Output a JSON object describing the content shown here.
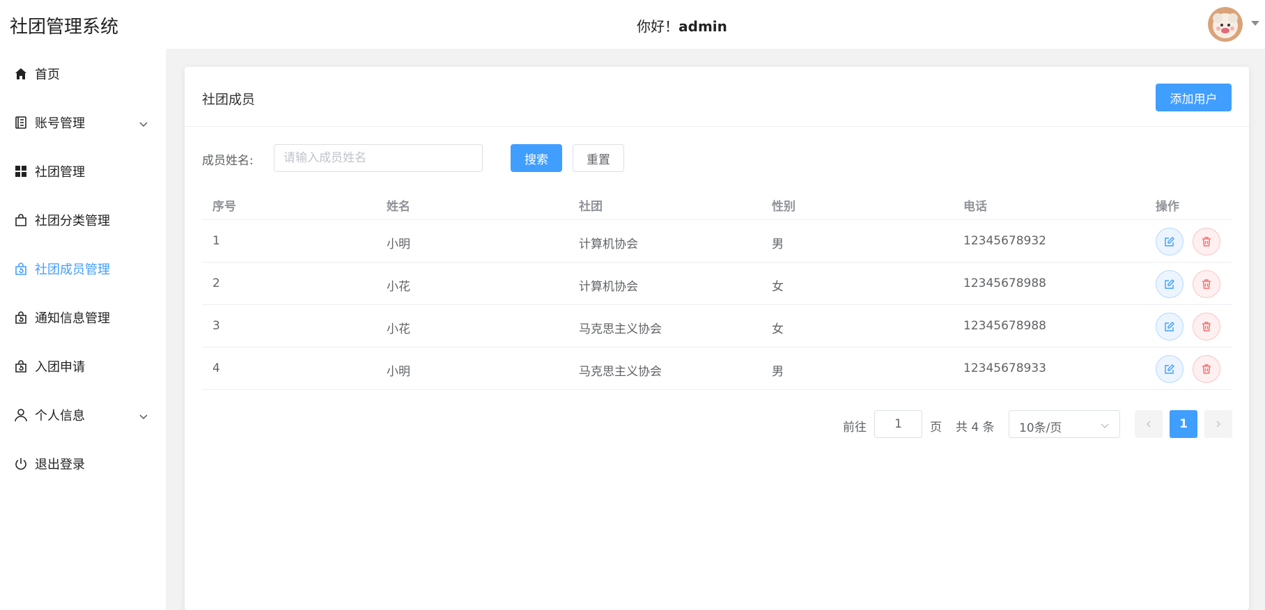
{
  "header": {
    "app_title": "社团管理系统",
    "greeting_prefix": "你好！",
    "username": "admin"
  },
  "sidebar": {
    "items": [
      {
        "label": "首页",
        "icon": "home-icon"
      },
      {
        "label": "账号管理",
        "icon": "document-icon",
        "expandable": true
      },
      {
        "label": "社团管理",
        "icon": "grid-icon"
      },
      {
        "label": "社团分类管理",
        "icon": "shopping-bag-icon"
      },
      {
        "label": "社团成员管理",
        "icon": "bag-refresh-icon",
        "active": true
      },
      {
        "label": "通知信息管理",
        "icon": "bag-refresh-icon"
      },
      {
        "label": "入团申请",
        "icon": "bag-refresh-icon"
      },
      {
        "label": "个人信息",
        "icon": "user-icon",
        "expandable": true
      },
      {
        "label": "退出登录",
        "icon": "power-icon"
      }
    ]
  },
  "card": {
    "title": "社团成员",
    "add_button": "添加用户"
  },
  "search": {
    "label": "成员姓名:",
    "placeholder": "请输入成员姓名",
    "value": "",
    "search_button": "搜索",
    "reset_button": "重置"
  },
  "table": {
    "columns": [
      "序号",
      "姓名",
      "社团",
      "性别",
      "电话",
      "操作"
    ],
    "rows": [
      [
        "1",
        "小明",
        "计算机协会",
        "男",
        "12345678932"
      ],
      [
        "2",
        "小花",
        "计算机协会",
        "女",
        "12345678988"
      ],
      [
        "3",
        "小花",
        "马克思主义协会",
        "女",
        "12345678988"
      ],
      [
        "4",
        "小明",
        "马克思主义协会",
        "男",
        "12345678933"
      ]
    ]
  },
  "pagination": {
    "goto_label": "前往",
    "goto_value": "1",
    "page_suffix": "页",
    "total_text": "共 4 条",
    "page_size": "10条/页",
    "current_page": "1"
  },
  "colors": {
    "primary": "#409eff",
    "danger": "#f56c6c",
    "background": "#f2f2f2"
  }
}
